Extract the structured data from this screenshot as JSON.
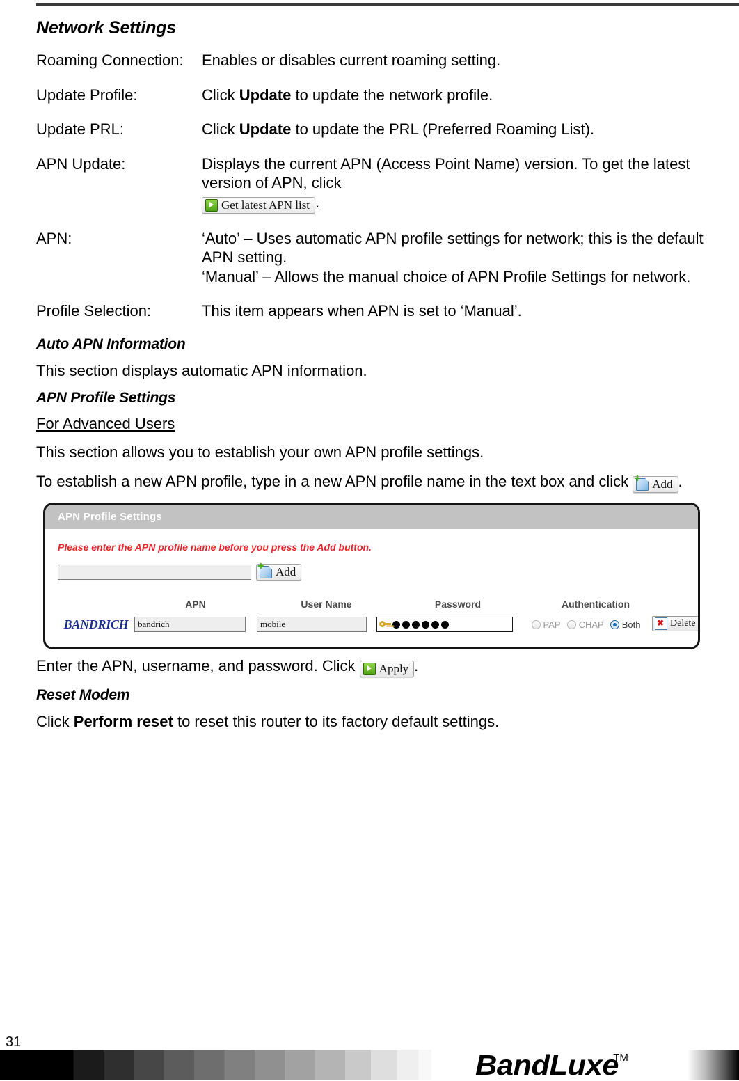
{
  "document": {
    "page_number": "31",
    "brand": "BandLuxe",
    "trademark": "TM"
  },
  "sections": {
    "network_settings": {
      "title": "Network Settings",
      "rows": [
        {
          "term": "Roaming Connection:",
          "desc_prefix": "Enables or disables current roaming setting.",
          "desc_bold": "",
          "desc_suffix": ""
        },
        {
          "term": "Update Profile:",
          "desc_prefix": "Click ",
          "desc_bold": "Update",
          "desc_suffix": " to update the network profile."
        },
        {
          "term": "Update PRL:",
          "desc_prefix": "Click ",
          "desc_bold": "Update",
          "desc_suffix": " to update the PRL (Preferred Roaming List)."
        }
      ],
      "apn_update": {
        "term": "APN Update:",
        "desc": "Displays the current APN (Access Point Name) version. To get the latest version of APN, click",
        "button_label": "Get latest APN list",
        "button_icon": "play-icon",
        "period": "."
      },
      "apn": {
        "term": "APN:",
        "line1": "‘Auto’ – Uses automatic APN profile settings for network; this is the default APN setting.",
        "line2": "‘Manual’ – Allows the manual choice of APN Profile Settings for network."
      },
      "profile_selection": {
        "term": "Profile Selection:",
        "desc": "This item appears when APN is set to ‘Manual’."
      }
    },
    "auto_apn_information": {
      "title": "Auto APN Information",
      "body": "This section displays automatic APN information."
    },
    "apn_profile_settings": {
      "title": "APN Profile Settings",
      "subheading": "For Advanced Users",
      "body1": "This section allows you to establish your own APN profile settings.",
      "body2_prefix": "To establish a new APN profile, type in a new APN profile name in the text box and click ",
      "add_button_label": "Add",
      "add_button_icon": "add-page-icon",
      "body2_suffix": ".",
      "after_panel_prefix": "Enter the APN, username, and password. Click ",
      "apply_button_label": "Apply",
      "apply_button_icon": "play-icon",
      "after_panel_suffix": "."
    },
    "reset_modem": {
      "title": "Reset Modem",
      "body_prefix": "Click ",
      "body_bold": "Perform reset",
      "body_suffix": " to reset this router to its factory default settings."
    }
  },
  "ui_panel": {
    "header_title": "APN Profile Settings",
    "warning_text": "Please enter the APN profile name before you press the Add button.",
    "new_profile_input": {
      "value": "",
      "placeholder": ""
    },
    "add_button": {
      "label": "Add",
      "icon": "add-page-icon"
    },
    "table": {
      "columns": [
        "APN",
        "User Name",
        "Password",
        "Authentication"
      ],
      "rows": [
        {
          "profile_name": "BANDRICH",
          "apn": "bandrich",
          "user_name": "mobile",
          "password_icon": "key-icon",
          "password_dots": 6,
          "authentication": {
            "options": [
              {
                "label": "PAP",
                "selected": false,
                "disabled": true
              },
              {
                "label": "CHAP",
                "selected": false,
                "disabled": true
              },
              {
                "label": "Both",
                "selected": true,
                "disabled": false
              }
            ]
          },
          "delete_button": {
            "label": "Delete",
            "icon": "delete-x-icon"
          }
        }
      ]
    }
  },
  "colors": {
    "panel_header_bg": "#c2c2c2",
    "warning_red": "#e8262b",
    "profile_name_blue": "#1b2f8f",
    "radio_selected_blue": "#1a6bb5"
  }
}
